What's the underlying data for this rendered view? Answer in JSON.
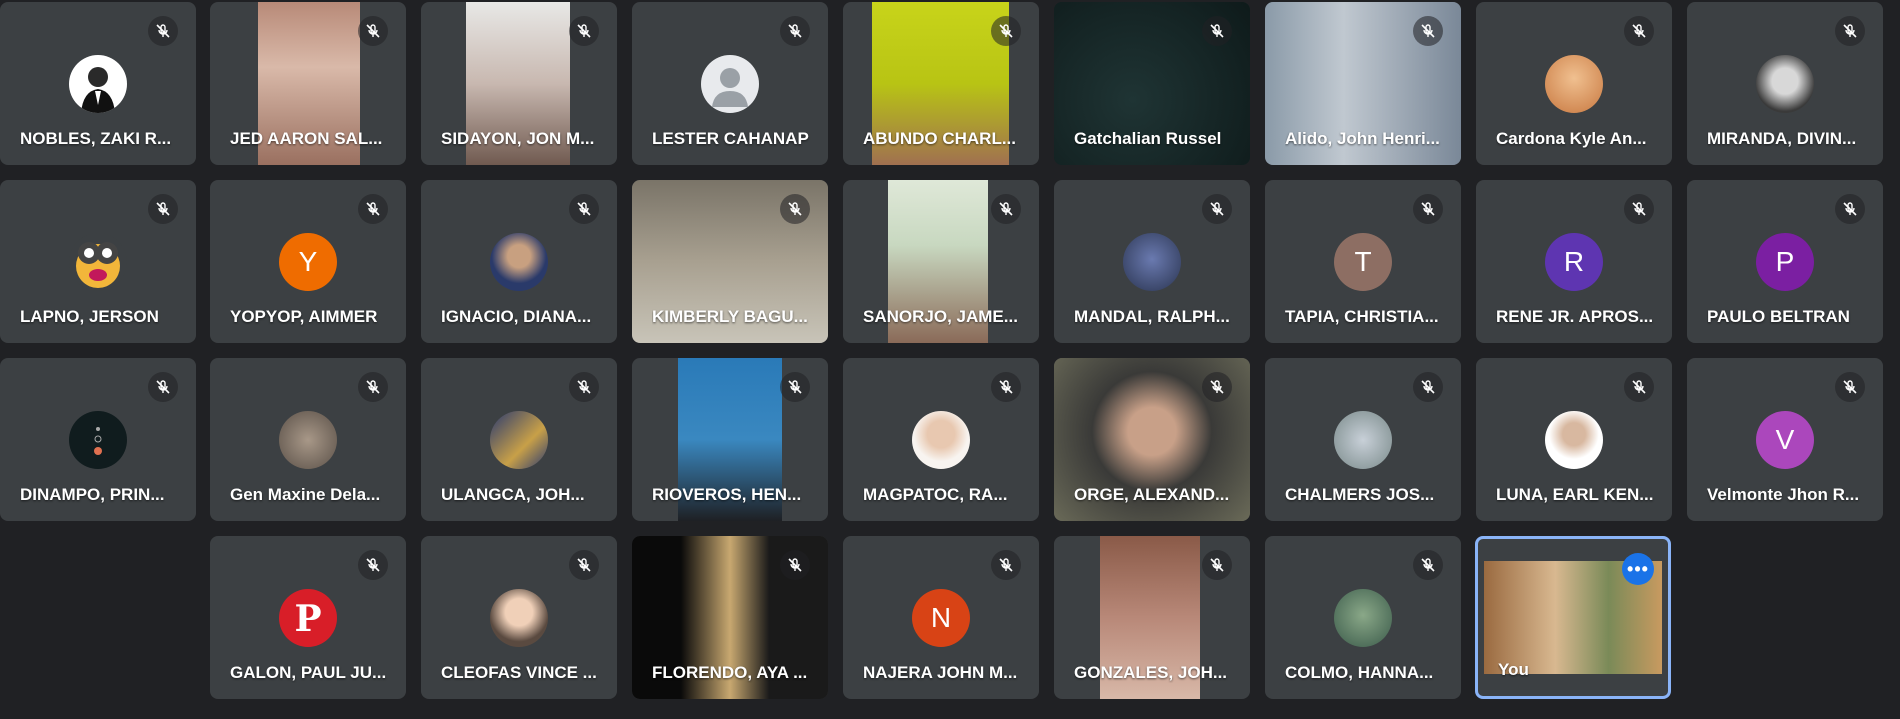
{
  "colors": {
    "background": "#202124",
    "tile": "#3c4043",
    "you_border": "#8ab4f8",
    "more_button": "#1a73e8"
  },
  "participants": [
    {
      "name": "NOBLES, ZAKI R...",
      "type": "photo",
      "avatar_color": "#ffffff",
      "icon": "mic-off-icon"
    },
    {
      "name": "JED AARON SAL...",
      "type": "video",
      "icon": "mic-off-icon"
    },
    {
      "name": "SIDAYON, JON M...",
      "type": "video",
      "icon": "mic-off-icon"
    },
    {
      "name": "LESTER CAHANAP",
      "type": "default-avatar",
      "avatar_color": "#e8eaed",
      "icon": "mic-off-icon"
    },
    {
      "name": "ABUNDO CHARL...",
      "type": "video",
      "icon": "mic-off-icon"
    },
    {
      "name": "Gatchalian Russel",
      "type": "video",
      "icon": "mic-off-icon"
    },
    {
      "name": "Alido, John Henri...",
      "type": "video",
      "icon": "mic-off-icon"
    },
    {
      "name": "Cardona Kyle An...",
      "type": "photo",
      "avatar_color": "#e0a060",
      "icon": "mic-off-icon"
    },
    {
      "name": "MIRANDA, DIVIN...",
      "type": "photo",
      "avatar_color": "#555555",
      "icon": "mic-off-icon"
    },
    {
      "name": "LAPNO, JERSON",
      "type": "photo",
      "avatar_color": "#f0c060",
      "icon": "mic-off-icon"
    },
    {
      "name": "YOPYOP, AIMMER",
      "type": "initial",
      "initial": "Y",
      "avatar_color": "#ef6c00",
      "icon": "mic-off-icon"
    },
    {
      "name": "IGNACIO, DIANA...",
      "type": "photo",
      "avatar_color": "#3a4a6a",
      "icon": "mic-off-icon"
    },
    {
      "name": "KIMBERLY BAGU...",
      "type": "video",
      "icon": "mic-off-icon"
    },
    {
      "name": "SANORJO, JAME...",
      "type": "video",
      "icon": "mic-off-icon"
    },
    {
      "name": "MANDAL, RALPH...",
      "type": "photo",
      "avatar_color": "#4a5a8a",
      "icon": "mic-off-icon"
    },
    {
      "name": "TAPIA, CHRISTIA...",
      "type": "initial",
      "initial": "T",
      "avatar_color": "#8d6e63",
      "icon": "mic-off-icon"
    },
    {
      "name": "RENE JR. APROS...",
      "type": "initial",
      "initial": "R",
      "avatar_color": "#5e35b1",
      "icon": "mic-off-icon"
    },
    {
      "name": "PAULO BELTRAN",
      "type": "initial",
      "initial": "P",
      "avatar_color": "#7b1fa2",
      "icon": "mic-off-icon"
    },
    {
      "name": "DINAMPO, PRIN...",
      "type": "photo",
      "avatar_color": "#1a2a2a",
      "icon": "mic-off-icon"
    },
    {
      "name": "Gen Maxine Dela...",
      "type": "photo",
      "avatar_color": "#8a7a6a",
      "icon": "mic-off-icon"
    },
    {
      "name": "ULANGCA, JOH...",
      "type": "photo",
      "avatar_color": "#3a4a7a",
      "icon": "mic-off-icon"
    },
    {
      "name": "RIOVEROS, HEN...",
      "type": "video",
      "icon": "mic-off-icon"
    },
    {
      "name": "MAGPATOC, RA...",
      "type": "photo",
      "avatar_color": "#f5ece6",
      "icon": "mic-off-icon"
    },
    {
      "name": "ORGE, ALEXAND...",
      "type": "video",
      "icon": "mic-off-icon"
    },
    {
      "name": "CHALMERS JOS...",
      "type": "photo",
      "avatar_color": "#9aa",
      "icon": "mic-off-icon"
    },
    {
      "name": "LUNA, EARL KEN...",
      "type": "photo",
      "avatar_color": "#ffffff",
      "icon": "mic-off-icon"
    },
    {
      "name": "Velmonte Jhon R...",
      "type": "initial",
      "initial": "V",
      "avatar_color": "#ab47bc",
      "icon": "mic-off-icon"
    },
    {
      "name": "GALON, PAUL JU...",
      "type": "photo",
      "avatar_color": "#ffffff",
      "icon": "mic-off-icon"
    },
    {
      "name": "CLEOFAS VINCE ...",
      "type": "photo",
      "avatar_color": "#c8a890",
      "icon": "mic-off-icon"
    },
    {
      "name": "FLORENDO, AYA ...",
      "type": "video",
      "icon": "mic-off-icon"
    },
    {
      "name": "NAJERA JOHN M...",
      "type": "initial",
      "initial": "N",
      "avatar_color": "#d84315",
      "icon": "mic-off-icon"
    },
    {
      "name": "GONZALES, JOH...",
      "type": "video",
      "icon": "mic-off-icon"
    },
    {
      "name": "COLMO, HANNA...",
      "type": "photo",
      "avatar_color": "#6a8a6a",
      "icon": "mic-off-icon"
    },
    {
      "name": "You",
      "type": "self-video",
      "icon": "more-options-icon",
      "more_label": "•••"
    }
  ]
}
